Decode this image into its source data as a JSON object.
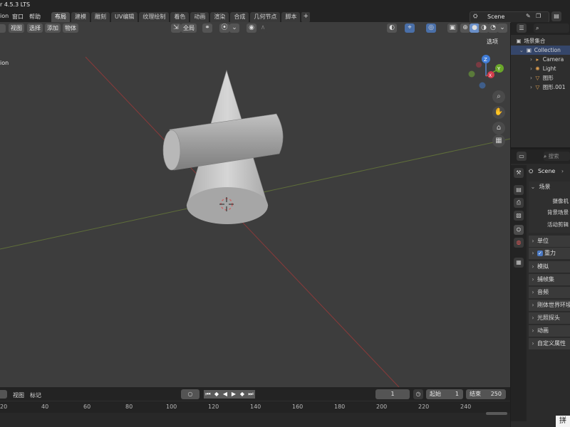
{
  "app": {
    "version": "r 4.5.3 LTS"
  },
  "menu": {
    "items": [
      "ion",
      "窗口",
      "帮助"
    ]
  },
  "workspace_tabs": [
    "布局",
    "建模",
    "雕刻",
    "UV编辑",
    "纹理绘制",
    "着色",
    "动画",
    "渲染",
    "合成",
    "几何节点",
    "脚本"
  ],
  "workspace_add": "+",
  "scene": {
    "name": "Scene"
  },
  "viewport": {
    "header_menu": [
      "视图",
      "选择",
      "添加",
      "物体"
    ],
    "orientation": "全局",
    "options_label": "选项",
    "corner_label": "ion",
    "gizmo": {
      "z": "Z",
      "y": "Y",
      "x": "X"
    }
  },
  "outliner": {
    "root": "场景集合",
    "collection": "Collection",
    "items": [
      {
        "name": "Camera",
        "icon": "camera-icon"
      },
      {
        "name": "Light",
        "icon": "light-icon"
      },
      {
        "name": "图形",
        "icon": "mesh-icon"
      },
      {
        "name": "图形.001",
        "icon": "mesh-icon"
      }
    ]
  },
  "properties": {
    "search_placeholder": "搜索",
    "scene_name": "Scene",
    "scene_panel": {
      "title": "场景",
      "fields": [
        "摄像机",
        "背景场景",
        "活动剪辑"
      ]
    },
    "sections": [
      "单位",
      "重力",
      "模拟",
      "捕帧集",
      "音频",
      "刚体世界环境",
      "光照探头",
      "动画",
      "自定义属性"
    ],
    "gravity_checked": true
  },
  "timeline": {
    "menu": [
      "视图",
      "标记"
    ],
    "current_frame": "1",
    "start_label": "起始",
    "start_value": "1",
    "end_label": "结束",
    "end_value": "250",
    "ruler": [
      "20",
      "40",
      "60",
      "80",
      "100",
      "120",
      "140",
      "160",
      "180",
      "200",
      "220",
      "240"
    ]
  },
  "status": {
    "ime": "拼"
  }
}
